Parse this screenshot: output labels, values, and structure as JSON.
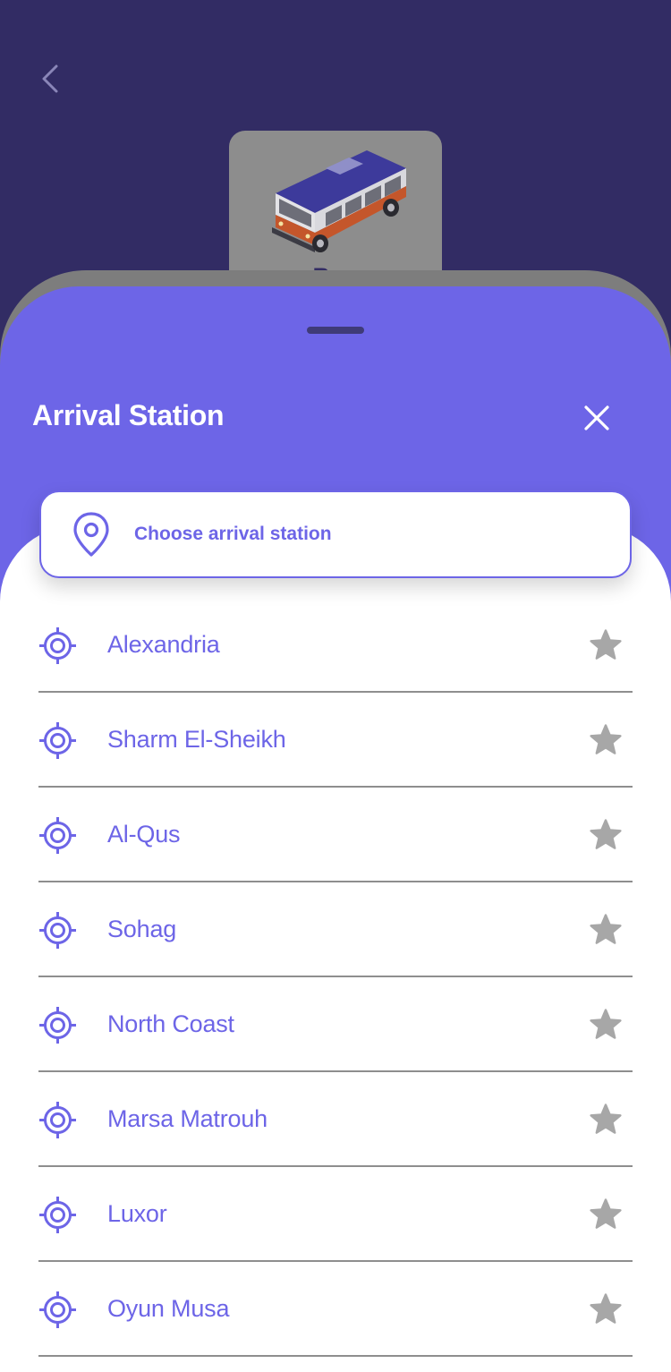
{
  "header": {
    "back_icon": "chevron-left-icon",
    "vehicle": {
      "label": "Bus",
      "icon": "bus-illustration"
    }
  },
  "sheet": {
    "title": "Arrival Station",
    "close_icon": "close-icon",
    "search": {
      "placeholder": "Choose arrival station",
      "icon": "map-pin-icon"
    }
  },
  "stations": [
    {
      "name": "Alexandria"
    },
    {
      "name": "Sharm El-Sheikh"
    },
    {
      "name": "Al-Qus"
    },
    {
      "name": "Sohag"
    },
    {
      "name": "North Coast"
    },
    {
      "name": "Marsa Matrouh"
    },
    {
      "name": "Luxor"
    },
    {
      "name": "Oyun Musa"
    }
  ],
  "colors": {
    "header_bg": "#322c64",
    "accent": "#6d65e7",
    "star": "#a7a7a7",
    "divider": "#8e8e8e"
  }
}
